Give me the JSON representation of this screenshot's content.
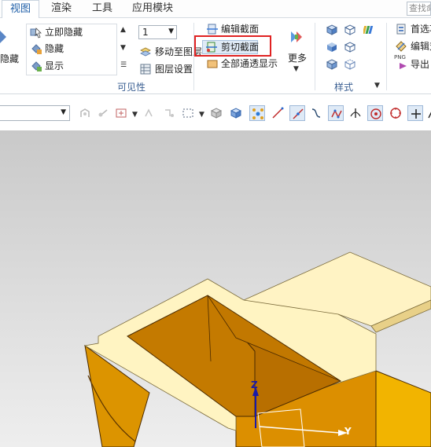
{
  "menubar": {
    "tabs": [
      {
        "label": "视图",
        "active": true
      },
      {
        "label": "渲染"
      },
      {
        "label": "工具"
      },
      {
        "label": "应用模块"
      }
    ],
    "search_placeholder": "查找命令"
  },
  "ribbon": {
    "hide_label": "隐藏",
    "visibility": {
      "immediate_hide": "立即隐藏",
      "hide": "隐藏",
      "show": "显示",
      "layer_value": "1",
      "move_to_layer": "移动至图层",
      "layer_settings": "图层设置",
      "group_label": "可见性"
    },
    "section": {
      "edit_section": "编辑截面",
      "clip_section": "剪切截面",
      "show_all_through": "全部通透显示"
    },
    "more_label": "更多",
    "style_group_label": "样式",
    "right_group": {
      "preferences": "首选项",
      "edit_object": "编辑对象",
      "export": "导出",
      "png_tag": "PNG"
    }
  },
  "viewport": {
    "axis_z": "Z",
    "axis_y": "Y"
  },
  "colors": {
    "accent": "#1f5fa8",
    "highlight_border": "#e02222",
    "model_top": "#fff4bf",
    "model_inner": "#c07800",
    "model_side": "#e09400"
  }
}
